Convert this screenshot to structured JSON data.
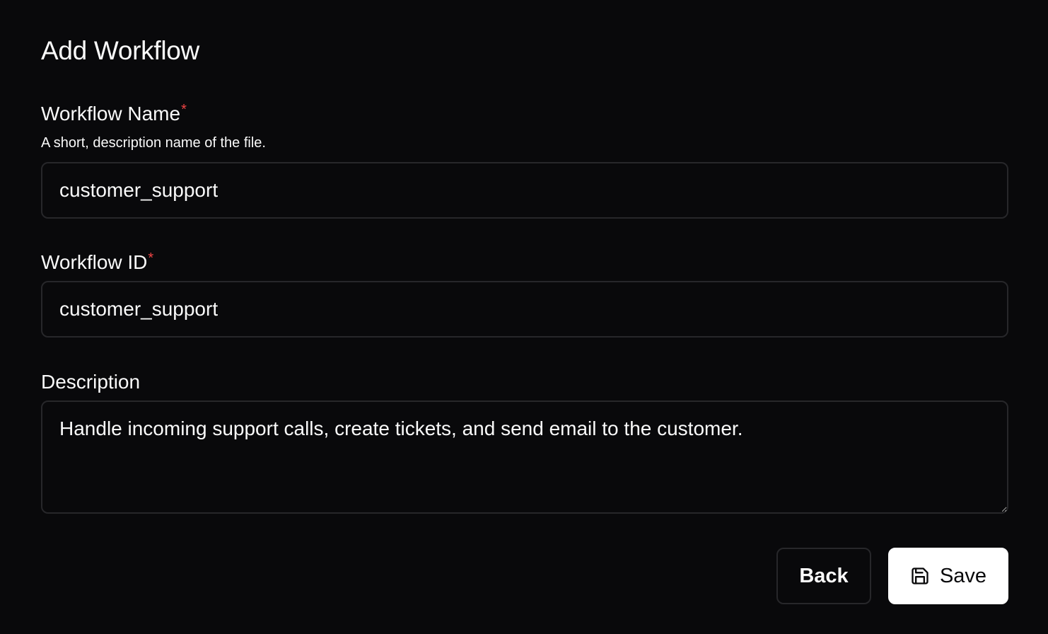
{
  "page": {
    "title": "Add Workflow"
  },
  "form": {
    "name": {
      "label": "Workflow Name",
      "required_mark": "*",
      "help": "A short, description name of the file.",
      "value": "customer_support"
    },
    "id": {
      "label": "Workflow ID",
      "required_mark": "*",
      "value": "customer_support"
    },
    "description": {
      "label": "Description",
      "value": "Handle incoming support calls, create tickets, and send email to the customer."
    }
  },
  "actions": {
    "back_label": "Back",
    "save_label": "Save",
    "save_icon": "floppy-disk-icon"
  },
  "colors": {
    "background": "#09090b",
    "border": "#27272a",
    "text": "#fafafa",
    "required": "#ef4444",
    "primary_button_bg": "#ffffff"
  }
}
